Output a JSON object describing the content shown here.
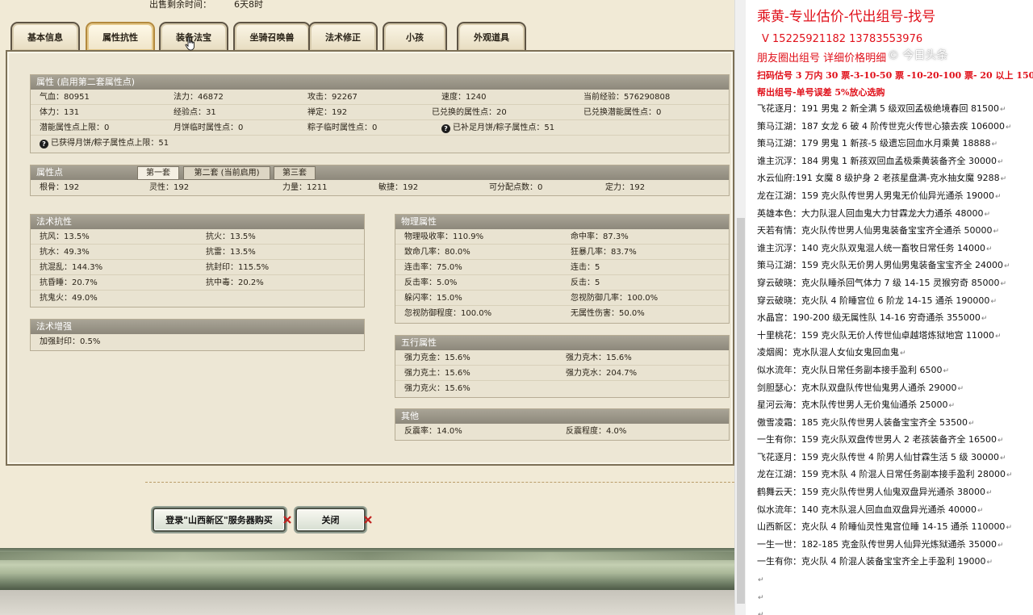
{
  "game": {
    "top_text": [
      "出售剩余时间：",
      "6天8时"
    ],
    "tabs": [
      {
        "label": "基本信息",
        "active": false
      },
      {
        "label": "属性抗性",
        "active": true
      },
      {
        "label": "装备法宝",
        "active": false
      },
      {
        "label": "坐骑召唤兽",
        "active": false
      },
      {
        "label": "法术修正",
        "active": false
      },
      {
        "label": "小孩",
        "active": false
      },
      {
        "label": "外观道具",
        "active": false
      }
    ],
    "attributes": {
      "title": "属性 (启用第二套属性点)",
      "rows": [
        [
          "气血：80951",
          "法力：46872",
          "攻击：92267",
          "速度：1240",
          "当前经验：576290808"
        ],
        [
          "体力：131",
          "经验点：31",
          "禅定：192",
          "已兑换的属性点：20",
          "已兑换潜能属性点：0"
        ],
        [
          "潜能属性点上限：0",
          "月饼临时属性点：0",
          "粽子临时属性点：0",
          "已补足月饼/粽子属性点：51",
          ""
        ],
        [
          "已获得月饼/粽子属性点上限：51",
          "",
          "",
          "",
          ""
        ]
      ]
    },
    "points": {
      "title": "属性点",
      "tabs": [
        {
          "label": "第一套",
          "active": true
        },
        {
          "label": "第二套 (当前启用)",
          "active": false
        },
        {
          "label": "第三套",
          "active": false
        }
      ],
      "row": [
        "根骨：192",
        "灵性：192",
        "力量：1211",
        "敏捷：192",
        "可分配点数：0",
        "定力：192"
      ]
    },
    "spell_resist": {
      "title": "法术抗性",
      "rows": [
        [
          "抗风：13.5%",
          "抗火：13.5%"
        ],
        [
          "抗水：49.3%",
          "抗雷：13.5%"
        ],
        [
          "抗混乱：144.3%",
          "抗封印：115.5%"
        ],
        [
          "抗昏睡：20.7%",
          "抗中毒：20.2%"
        ],
        [
          "抗鬼火：49.0%",
          ""
        ]
      ]
    },
    "spell_boost": {
      "title": "法术增强",
      "rows": [
        [
          "加强封印：0.5%"
        ]
      ]
    },
    "physical": {
      "title": "物理属性",
      "rows": [
        [
          "物理吸收率：110.9%",
          "命中率：87.3%"
        ],
        [
          "致命几率：80.0%",
          "狂暴几率：83.7%"
        ],
        [
          "连击率：75.0%",
          "连击：5"
        ],
        [
          "反击率：5.0%",
          "反击：5"
        ],
        [
          "躲闪率：15.0%",
          "忽视防御几率：100.0%"
        ],
        [
          "忽视防御程度：100.0%",
          "无属性伤害：50.0%"
        ]
      ]
    },
    "five_elements": {
      "title": "五行属性",
      "rows": [
        [
          "强力克金：15.6%",
          "强力克木：15.6%"
        ],
        [
          "强力克土：15.6%",
          "强力克水：204.7%"
        ],
        [
          "强力克火：15.6%",
          ""
        ]
      ]
    },
    "other": {
      "title": "其他",
      "rows": [
        [
          "反震率：14.0%",
          "反震程度：4.0%"
        ]
      ]
    },
    "buttons": {
      "login_buy": "登录\"山西新区\"服务器购买",
      "close": "关闭"
    }
  },
  "ad": {
    "title": "乘黄-专业估价-代出组号-找号",
    "phone": "V 15225921182   13783553976",
    "circle": "朋友圈出组号    详细价格明细",
    "overlay": "© 今日头条",
    "scan": "扫码估号 3 万内 30 票-3-10-50 票  -10-20-100 票- 20 以上 150",
    "guarantee": "帮出组号-单号误差 5%放心选购",
    "listings": [
      "飞花逐月：191 男鬼 2 新全满 5 级双回孟极绝境春回 81500",
      "策马江湖：187 女龙 6 破 4 阶传世克火传世心猿去疾 106000",
      "策马江湖：179 男鬼 1 新孩-5 级遗忘回血水月乘黄 18888",
      "谁主沉浮：184 男鬼 1 新孩双回血孟极乘黄装备齐全 30000",
      "水云仙府:191 女魔 8 级护身 2 老孩星盘满-克水抽女魔 9288",
      "龙在江湖：159 克火队传世男人男鬼无价仙异光通杀 19000",
      "英雄本色：大力队混人回血鬼大力甘霖龙大力通杀 48000",
      "天若有情：克火队传世男人仙男鬼装备宝宝齐全通杀 50000",
      "谁主沉浮：140 克火队双鬼混人统一畜牧日常任务 14000",
      "策马江湖：159 克火队无价男人男仙男鬼装备宝宝齐全 24000",
      "穿云破晓：克火队睡杀回气体力 7 级 14-15 灵猴穷奇 85000",
      "穿云破晓：克火队 4 阶睡宫位 6 阶龙 14-15 通杀 190000",
      "水晶宫：190-200 级无属性队 14-16 穷奇通杀 355000",
      "十里桃花：159 克火队无价人传世仙卓越塔炼狱地宫 11000",
      "凌烟阁：克水队混人女仙女鬼回血鬼",
      "似水流年：克火队日常任务副本接手盈利 6500",
      "剑胆瑟心：克木队双盘队传世仙鬼男人通杀 29000",
      "星河云海：克木队传世男人无价鬼仙通杀 25000",
      "傲雪凌霜：185 克火队传世男人装备宝宝齐全 53500",
      "一生有你：159 克火队双盘传世男人 2 老孩装备齐全 16500",
      "飞花逐月：159 克火队传世 4 阶男人仙甘霖生活 5 级 30000",
      "龙在江湖：159 克木队 4 阶混人日常任务副本接手盈利 28000",
      "鹤舞云天：159 克火队传世男人仙鬼双盘异光通杀 38000",
      "似水流年：140 克木队混人回血血双盘异光通杀 40000",
      "山西新区：克火队 4 阶睡仙灵性鬼宫位睡 14-15 通杀 110000",
      "一生一世：182-185 克金队传世男人仙异光炼狱通杀 35000",
      "一生有你：克火队 4 阶混人装备宝宝齐全上手盈利 19000"
    ],
    "return_mark": "↵"
  }
}
